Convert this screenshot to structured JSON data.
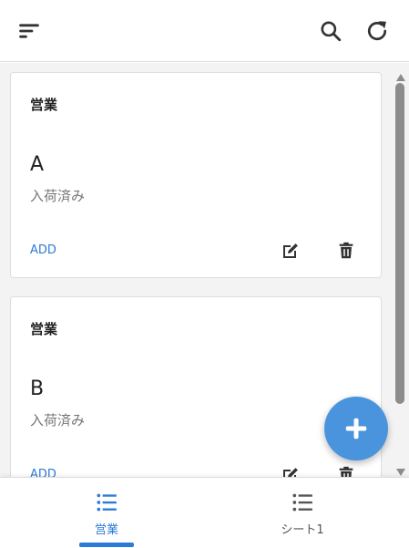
{
  "toolbar": {
    "menu_icon": "sort-menu-icon",
    "search_icon": "search-icon",
    "refresh_icon": "refresh-icon"
  },
  "cards": [
    {
      "title": "営業",
      "name": "A",
      "status": "入荷済み",
      "add_label": "ADD"
    },
    {
      "title": "営業",
      "name": "B",
      "status": "入荷済み",
      "add_label": "ADD"
    }
  ],
  "fab": {
    "icon": "plus-icon"
  },
  "bottom_nav": {
    "tabs": [
      {
        "label": "営業",
        "icon": "list-icon",
        "selected": true
      },
      {
        "label": "シート1",
        "icon": "list-icon",
        "selected": false
      }
    ]
  },
  "colors": {
    "accent": "#2e7bd6",
    "fab": "#4a94dd",
    "background": "#f3f3f3",
    "muted_text": "#757575"
  }
}
